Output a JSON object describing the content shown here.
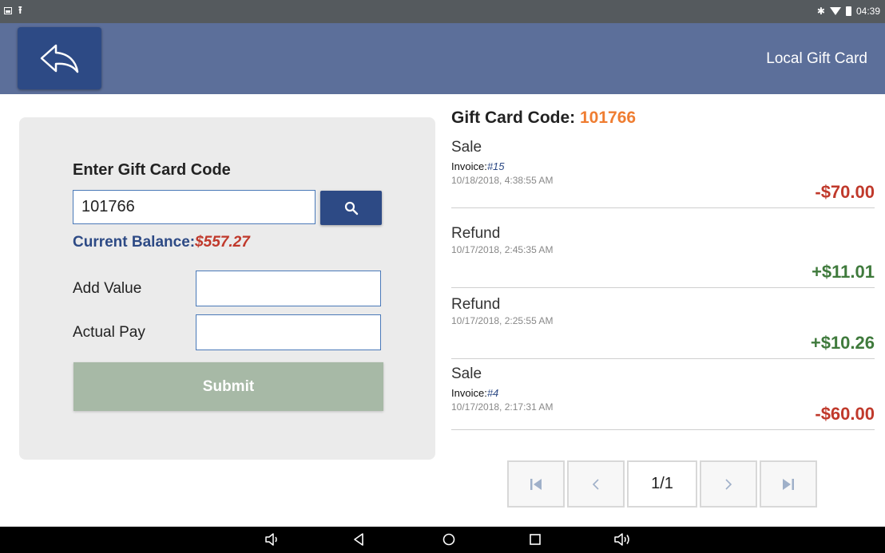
{
  "status_bar": {
    "time": "04:39",
    "left_icons": [
      "image-icon",
      "upload-icon"
    ],
    "right_icons": [
      "bluetooth-icon",
      "wifi-icon",
      "battery-icon"
    ]
  },
  "header": {
    "title": "Local Gift Card",
    "back_icon": "back-arrow-icon"
  },
  "form": {
    "title": "Enter Gift Card Code",
    "code_value": "101766",
    "search_icon": "search-icon",
    "balance_label": "Current Balance:",
    "balance_value": "$557.27",
    "add_value_label": "Add Value",
    "add_value_value": "",
    "actual_pay_label": "Actual Pay",
    "actual_pay_value": "",
    "submit_label": "Submit"
  },
  "transactions": {
    "title": "Gift Card Code: ",
    "code": "101766",
    "items": [
      {
        "type": "Sale",
        "invoice_label": "Invoice:",
        "invoice": "#15",
        "date": "10/18/2018, 4:38:55 AM",
        "amount": "-$70.00"
      },
      {
        "type": "Refund",
        "date": "10/17/2018, 2:45:35 AM",
        "amount": "+$11.01"
      },
      {
        "type": "Refund",
        "date": "10/17/2018, 2:25:55 AM",
        "amount": "+$10.26"
      },
      {
        "type": "Sale",
        "invoice_label": "Invoice:",
        "invoice": "#4",
        "date": "10/17/2018, 2:17:31 AM",
        "amount": "-$60.00"
      }
    ]
  },
  "pagination": {
    "page": "1/1",
    "first_icon": "first-page-icon",
    "prev_icon": "chevron-left-icon",
    "next_icon": "chevron-right-icon",
    "last_icon": "last-page-icon"
  },
  "nav_bar": {
    "icons": [
      "volume-down-icon",
      "back-icon",
      "home-icon",
      "recents-icon",
      "volume-up-icon"
    ]
  },
  "colors": {
    "header": "#5c6f9a",
    "primary_button": "#2d4a85",
    "negative": "#c0392b",
    "positive": "#3f7a3c",
    "code_accent": "#ef7d31",
    "submit_disabled": "#a7b9a6"
  }
}
